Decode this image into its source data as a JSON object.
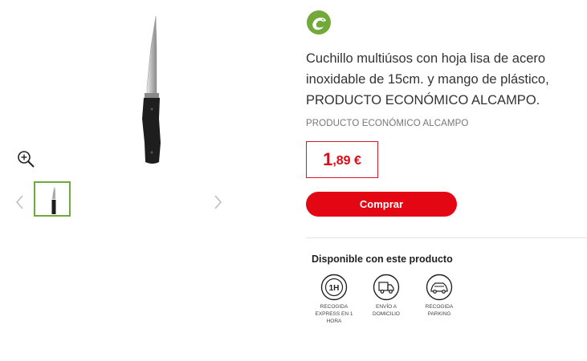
{
  "product": {
    "title": "Cuchillo multiúsos con hoja lisa de acero inoxidable de 15cm. y mango de plástico, PRODUCTO ECONÓMICO ALCAMPO.",
    "brand": "PRODUCTO ECONÓMICO ALCAMPO",
    "brand_logo_icon": "alcampo-bird-icon",
    "price": {
      "integer": "1",
      "rest": ",89 €"
    },
    "buy_label": "Comprar"
  },
  "gallery": {
    "zoom_icon": "zoom-in-icon",
    "prev_icon": "chevron-left-icon",
    "next_icon": "chevron-right-icon"
  },
  "availability": {
    "title": "Disponible con este producto",
    "services": [
      {
        "icon": "one-hour-clock-icon",
        "label": "RECOGIDA EXPRESS EN 1 HORA"
      },
      {
        "icon": "delivery-truck-icon",
        "label": "ENVÍO A DOMICILIO"
      },
      {
        "icon": "car-parking-icon",
        "label": "RECOGIDA PARKING"
      }
    ]
  },
  "colors": {
    "accent": "#e30613",
    "brand_green": "#72a93b",
    "border": "#cf1c2c"
  }
}
